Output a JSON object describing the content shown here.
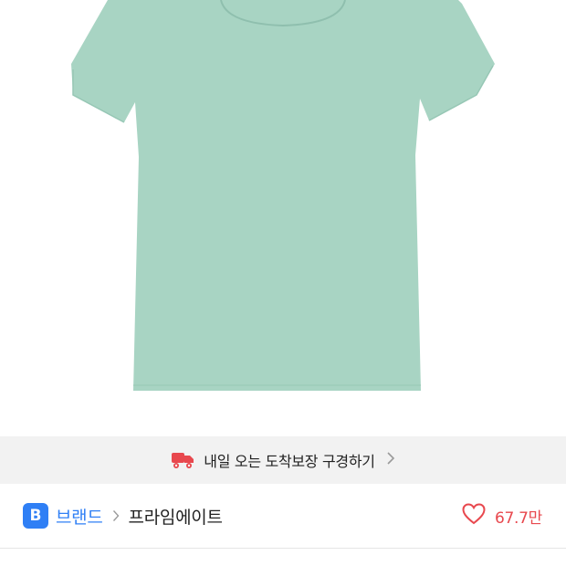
{
  "product": {
    "image_alt": "T-shirt",
    "image_color": "#a8d4c3"
  },
  "delivery_banner": {
    "icon": "delivery-truck-icon",
    "text": "내일 오는 도착보장 구경하기",
    "icon_color": "#e8484e"
  },
  "brand_row": {
    "badge_letter": "B",
    "brand_label": "브랜드",
    "brand_name": "프라임에이트",
    "like_count": "67.7만",
    "accent_color": "#2f7ff5",
    "like_color": "#e8484e"
  }
}
